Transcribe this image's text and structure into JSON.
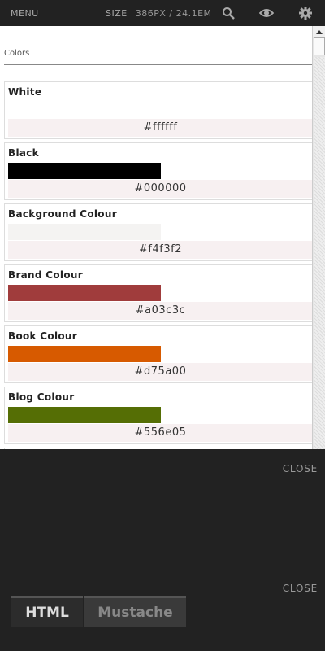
{
  "toolbar": {
    "menu_label": "MENU",
    "size_label": "SIZE",
    "size_value": "386PX / 24.1EM",
    "icons": [
      "search-icon",
      "eye-icon",
      "gear-icon"
    ]
  },
  "viewport": {
    "section_title": "Colors",
    "swatches": [
      {
        "name": "White",
        "code": "#ffffff",
        "color": "#ffffff"
      },
      {
        "name": "Black",
        "code": "#000000",
        "color": "#000000"
      },
      {
        "name": "Background Colour",
        "code": "#f4f3f2",
        "color": "#f4f3f2"
      },
      {
        "name": "Brand Colour",
        "code": "#a03c3c",
        "color": "#a03c3c"
      },
      {
        "name": "Book Colour",
        "code": "#d75a00",
        "color": "#d75a00"
      },
      {
        "name": "Blog Colour",
        "code": "#556e05",
        "color": "#556e05"
      }
    ]
  },
  "drawer": {
    "close_label_1": "CLOSE",
    "close_label_2": "CLOSE",
    "tabs": [
      {
        "label": "HTML",
        "active": true
      },
      {
        "label": "Mustache",
        "active": false
      }
    ]
  }
}
